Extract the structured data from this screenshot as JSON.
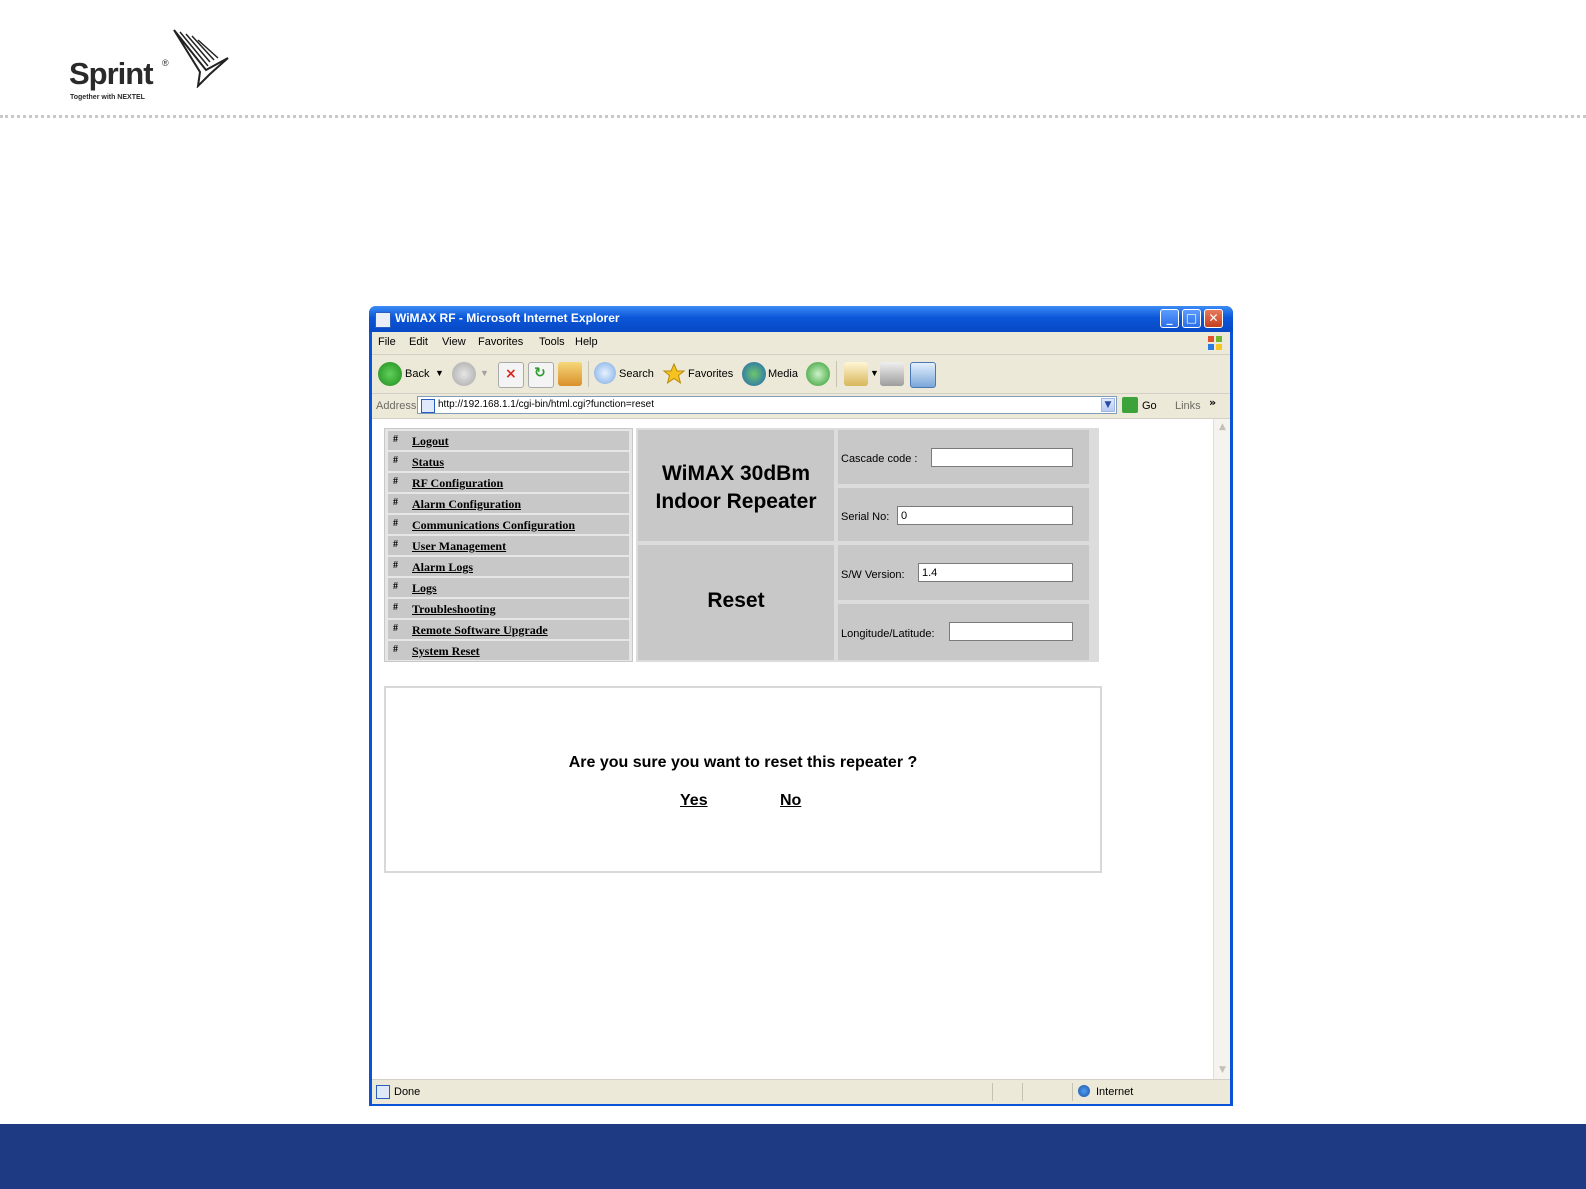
{
  "slide": {
    "logo_word": "Sprint",
    "logo_reg": "®",
    "logo_tagline": "Together with NEXTEL"
  },
  "browser": {
    "title": "WiMAX RF - Microsoft Internet Explorer",
    "controls": {
      "minimize": "_",
      "maximize": "□",
      "close": "✕"
    },
    "menu": [
      "File",
      "Edit",
      "View",
      "Favorites",
      "Tools",
      "Help"
    ],
    "toolbar": {
      "back": "Back",
      "search": "Search",
      "favorites": "Favorites",
      "media": "Media"
    },
    "address": {
      "label": "Address",
      "url": "http://192.168.1.1/cgi-bin/html.cgi?function=reset",
      "go": "Go",
      "links": "Links",
      "chevron": "»"
    },
    "status": {
      "text": "Done",
      "zone": "Internet"
    }
  },
  "page": {
    "nav_items": [
      "Logout",
      "Status",
      "RF Configuration",
      "Alarm Configuration",
      "Communications Configuration",
      "User Management",
      "Alarm Logs",
      "Logs",
      "Troubleshooting",
      "Remote Software Upgrade",
      "System Reset"
    ],
    "nav_bullet": "#",
    "product_title_line1": "WiMAX 30dBm",
    "product_title_line2": "Indoor Repeater",
    "section_title": "Reset",
    "fields": {
      "cascade_code": {
        "label": "Cascade code :",
        "value": ""
      },
      "serial_no": {
        "label": "Serial No:",
        "value": "0"
      },
      "sw_version": {
        "label": "S/W Version:",
        "value": "1.4"
      },
      "lon_lat": {
        "label": "Longitude/Latitude:",
        "value": ""
      }
    },
    "confirm": {
      "message": "Are you sure you want to reset this repeater ?",
      "yes": "Yes",
      "no": "No"
    }
  },
  "colors": {
    "bottom_band": "#1e3a83",
    "titlebar": "#0a56d8",
    "panel_gray": "#c8c8c8"
  }
}
